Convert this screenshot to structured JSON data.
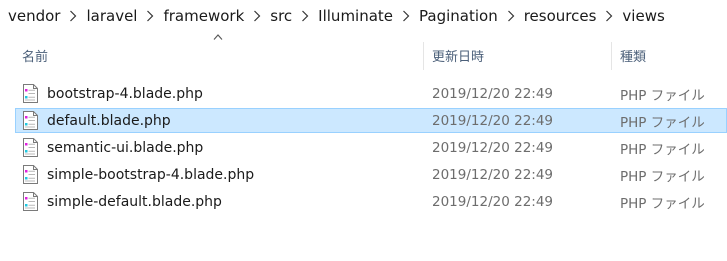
{
  "breadcrumb": [
    "vendor",
    "laravel",
    "framework",
    "src",
    "Illuminate",
    "Pagination",
    "resources",
    "views"
  ],
  "columns": {
    "name": "名前",
    "date": "更新日時",
    "type": "種類"
  },
  "files": [
    {
      "name": "bootstrap-4.blade.php",
      "date": "2019/12/20 22:49",
      "type": "PHP ファイル",
      "selected": false
    },
    {
      "name": "default.blade.php",
      "date": "2019/12/20 22:49",
      "type": "PHP ファイル",
      "selected": true
    },
    {
      "name": "semantic-ui.blade.php",
      "date": "2019/12/20 22:49",
      "type": "PHP ファイル",
      "selected": false
    },
    {
      "name": "simple-bootstrap-4.blade.php",
      "date": "2019/12/20 22:49",
      "type": "PHP ファイル",
      "selected": false
    },
    {
      "name": "simple-default.blade.php",
      "date": "2019/12/20 22:49",
      "type": "PHP ファイル",
      "selected": false
    }
  ],
  "icons": {
    "separator": "chevron-right-icon",
    "sort": "sort-ascending-icon",
    "file": "php-file-icon"
  },
  "colors": {
    "selection_bg": "#cce8ff",
    "selection_border": "#99d1ff",
    "header_text": "#4c607a",
    "secondary_text": "#6d6d6d"
  }
}
